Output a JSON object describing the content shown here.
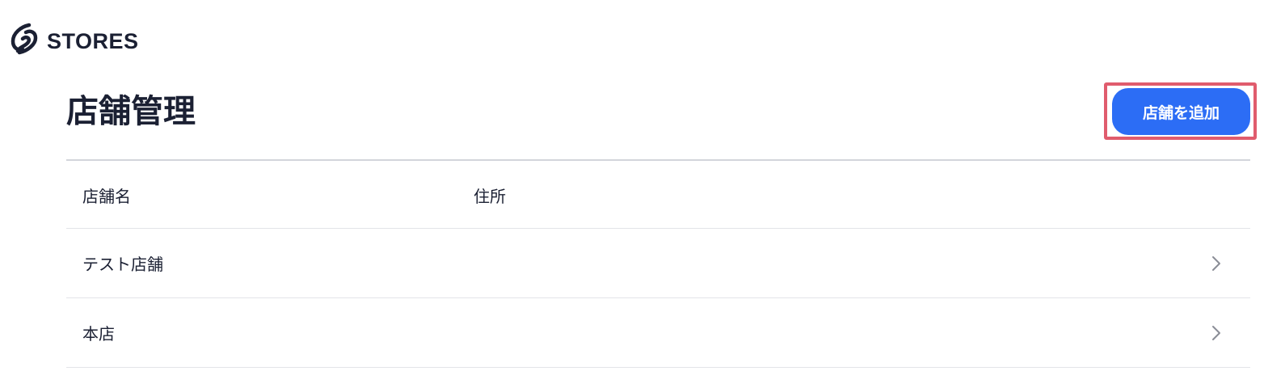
{
  "header": {
    "logo_text": "STORES"
  },
  "page": {
    "title": "店舗管理",
    "add_button_label": "店舗を追加"
  },
  "table": {
    "columns": [
      "店舗名",
      "住所"
    ],
    "rows": [
      {
        "name": "テスト店舗",
        "address": ""
      },
      {
        "name": "本店",
        "address": ""
      }
    ]
  },
  "colors": {
    "primary": "#2c6df5",
    "highlight": "#e05c6d",
    "text": "#1b2033"
  },
  "icons": {
    "logo": "stores-logo-icon",
    "row_arrow": "chevron-right-icon"
  }
}
